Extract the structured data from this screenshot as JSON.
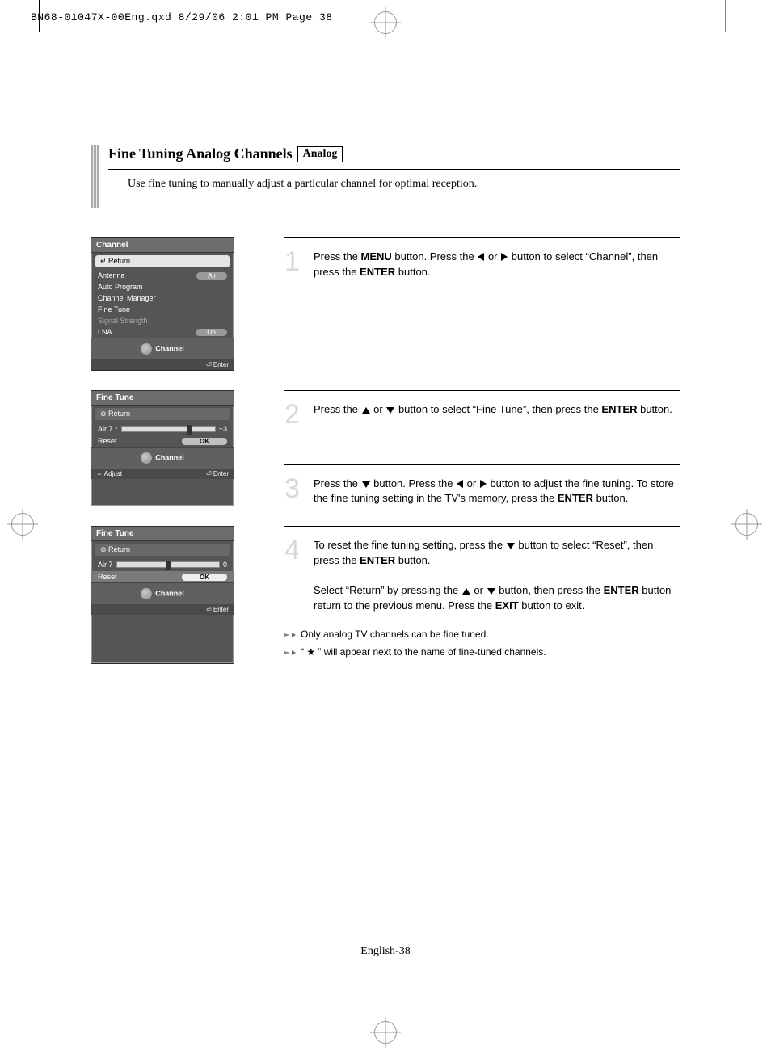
{
  "qxd_line": "BN68-01047X-00Eng.qxd  8/29/06  2:01 PM  Page 38",
  "section_title": "Fine Tuning Analog Channels",
  "analog_badge": "Analog",
  "intro": "Use fine tuning to manually adjust a particular channel for optimal reception.",
  "steps": {
    "s1a": "Press the ",
    "s1b": " button. Press the ",
    "s1c": " or ",
    "s1d": " button to select “Channel”, then press the ",
    "s1e": " button.",
    "s1menu": "MENU",
    "s1enter": "ENTER",
    "s2a": "Press the ",
    "s2b": " or ",
    "s2c": " button to select “Fine Tune”, then press the ",
    "s2enter": "ENTER",
    "s2d": " button.",
    "s3a": "Press the ",
    "s3b": " button. Press the ",
    "s3c": " or ",
    "s3d": " button to adjust the fine tuning. To store the fine tuning setting in the TV's memory, press the ",
    "s3enter": "ENTER",
    "s3e": " button.",
    "s4a": "To reset the fine tuning setting, press the ",
    "s4b": " button to select “Reset”, then press the ",
    "s4enter": "ENTER",
    "s4c": " button.",
    "s4d": "Select “Return” by pressing the ",
    "s4e": " or ",
    "s4f": " button, then press the ",
    "s4enter2": "ENTER",
    "s4g": " button return to the previous menu. Press the ",
    "s4exit": "EXIT",
    "s4h": " button to exit."
  },
  "notes": {
    "n1": "Only analog TV channels can be fine tuned.",
    "n2": "“ ★ ” will appear next to the name of fine-tuned channels."
  },
  "page_number": "English-38",
  "osd1": {
    "title": "Channel",
    "return": "Return",
    "rows": {
      "antenna_lbl": "Antenna",
      "antenna_val": "Air",
      "auto": "Auto Program",
      "mgr": "Channel Manager",
      "fine": "Fine Tune",
      "signal": "Signal Strength",
      "lna_lbl": "LNA",
      "lna_val": "On"
    },
    "swoosh": "Channel",
    "foot_enter": "Enter"
  },
  "osd2": {
    "title": "Fine Tune",
    "return": "Return",
    "ch_lbl": "Air 7 *",
    "ch_val": "+3",
    "reset": "Reset",
    "ok": "OK",
    "swoosh": "Channel",
    "foot_adjust": "Adjust",
    "foot_enter": "Enter"
  },
  "osd3": {
    "title": "Fine Tune",
    "return": "Return",
    "ch_lbl": "Air 7",
    "ch_val": "0",
    "reset": "Reset",
    "ok": "OK",
    "swoosh": "Channel",
    "foot_enter": "Enter"
  }
}
